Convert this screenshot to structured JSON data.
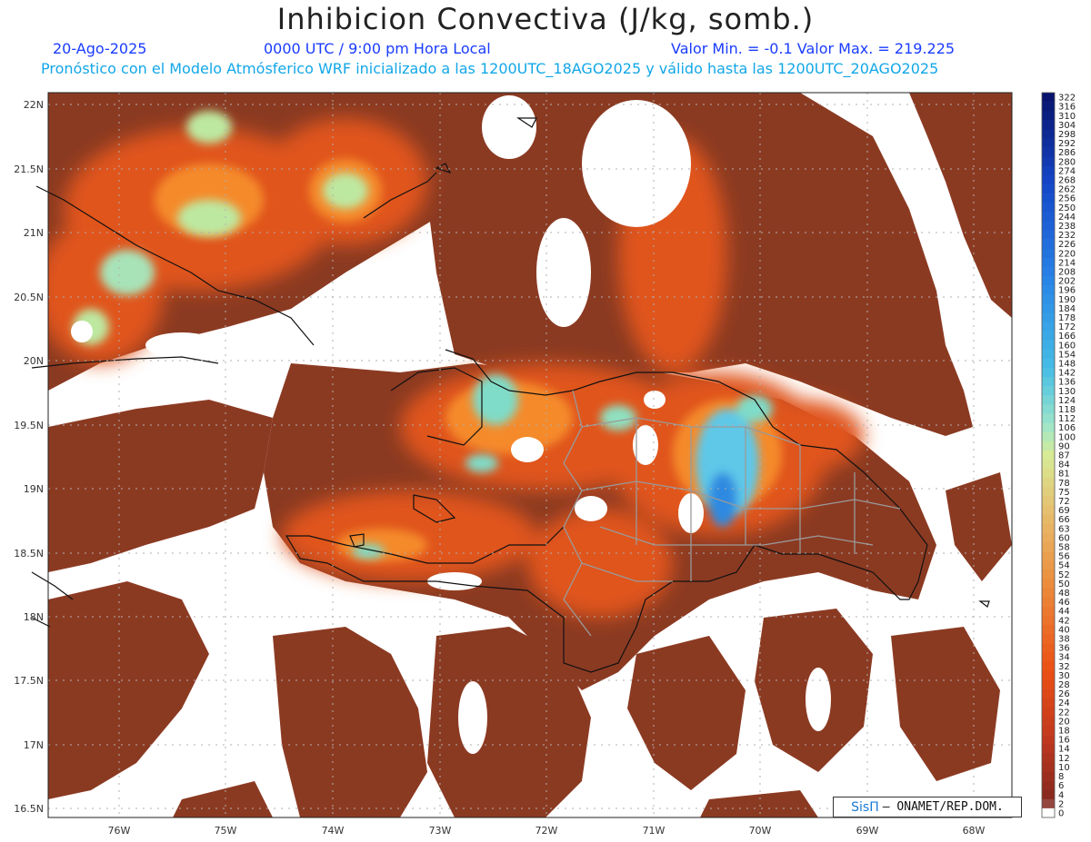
{
  "header": {
    "title": "Inhibicion Convectiva (J/kg, somb.)",
    "date": "20-Ago-2025",
    "time": "0000 UTC / 9:00 pm Hora Local",
    "minmax": "Valor Min. = -0.1  Valor Max. = 219.225",
    "forecast": "Pronóstico con el Modelo Atmósferico WRF inicializado a las 1200UTC_18AGO2025 y válido hasta las  1200UTC_20AGO2025"
  },
  "axes": {
    "lat_labels": [
      "22N",
      "21.5N",
      "21N",
      "20.5N",
      "20N",
      "19.5N",
      "19N",
      "18.5N",
      "18N",
      "17.5N",
      "17N",
      "16.5N"
    ],
    "lon_labels": [
      "76W",
      "75W",
      "74W",
      "73W",
      "72W",
      "71W",
      "70W",
      "69W",
      "68W"
    ]
  },
  "legend": {
    "labels": [
      "322",
      "316",
      "310",
      "304",
      "298",
      "292",
      "286",
      "280",
      "274",
      "268",
      "262",
      "256",
      "250",
      "244",
      "238",
      "232",
      "226",
      "220",
      "214",
      "208",
      "202",
      "196",
      "190",
      "184",
      "178",
      "172",
      "166",
      "160",
      "154",
      "148",
      "142",
      "136",
      "130",
      "124",
      "118",
      "112",
      "106",
      "100",
      "90",
      "87",
      "84",
      "81",
      "78",
      "75",
      "72",
      "69",
      "66",
      "63",
      "60",
      "58",
      "56",
      "54",
      "52",
      "50",
      "48",
      "46",
      "44",
      "42",
      "40",
      "38",
      "36",
      "34",
      "32",
      "30",
      "28",
      "26",
      "24",
      "22",
      "20",
      "18",
      "16",
      "14",
      "12",
      "10",
      "8",
      "6",
      "4",
      "2",
      "0"
    ]
  },
  "credit": {
    "brand": "SisΠ",
    "text": "– ONAMET/REP.DOM."
  },
  "colors": {
    "low": "#8b3a22",
    "mid": "#f26b1a",
    "high": "#bde8a0",
    "peak": "#1e6fd9"
  }
}
